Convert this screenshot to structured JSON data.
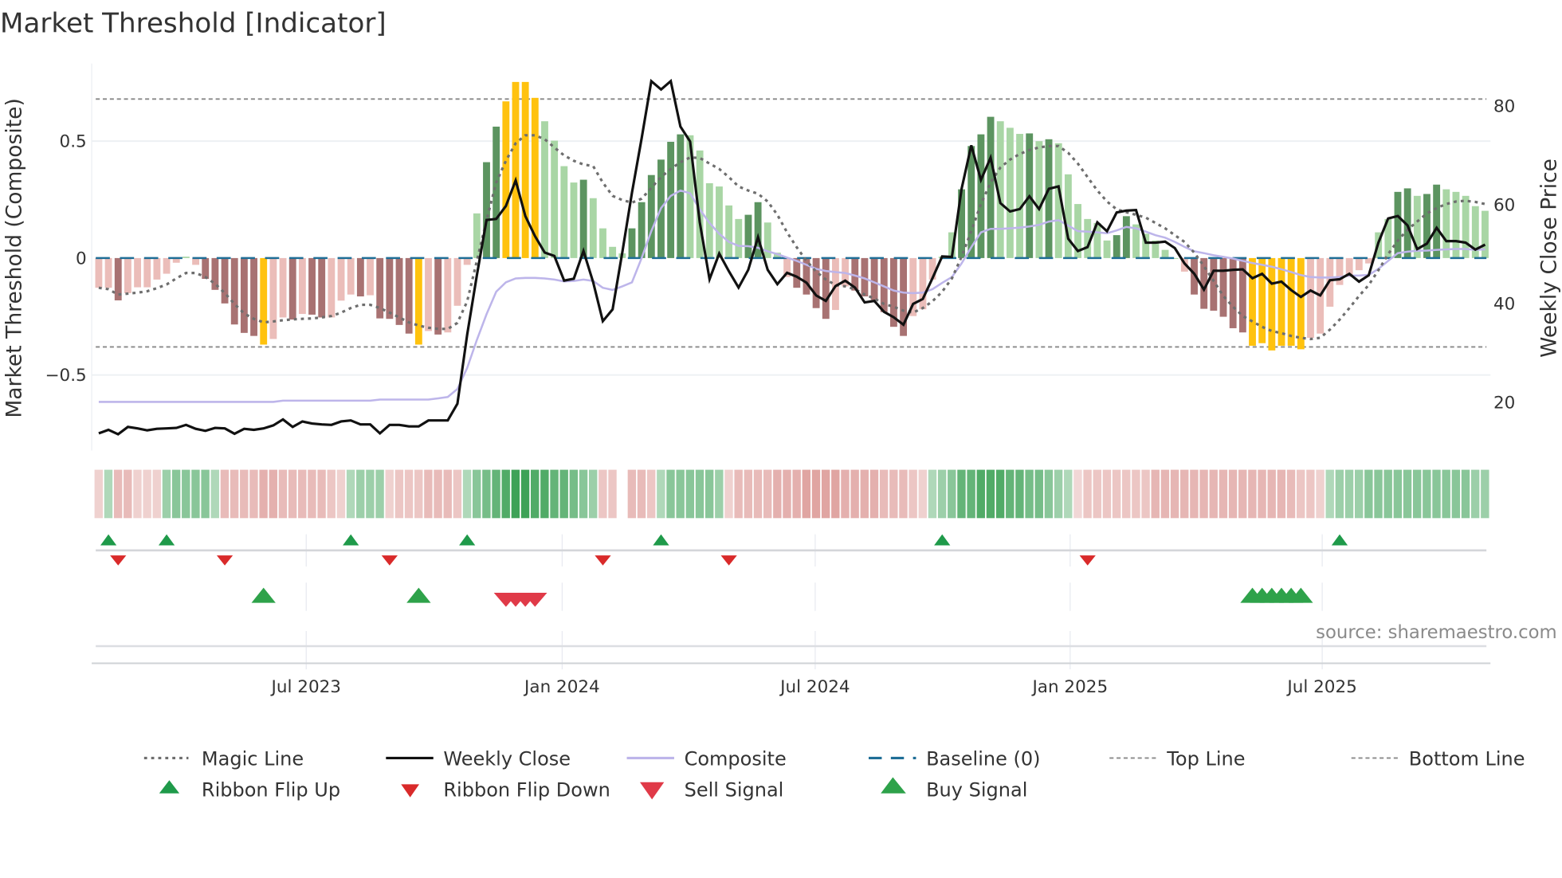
{
  "title": "Market Threshold [Indicator]",
  "source": "source: sharemaestro.com",
  "chart_data": {
    "type": "bar",
    "title": "Market Threshold [Indicator]",
    "ylabel": "Market Threshold (Composite)",
    "ylabel_right": "Weekly Close Price",
    "ylim": [
      -0.8,
      0.78
    ],
    "ylim_right": [
      10,
      90
    ],
    "yticks": [
      {
        "label": "0.5",
        "value": 0.5
      },
      {
        "label": "0",
        "value": 0
      },
      {
        "label": "−0.5",
        "value": -0.5
      }
    ],
    "yticks_right": [
      {
        "label": "80",
        "value": 80
      },
      {
        "label": "60",
        "value": 60
      },
      {
        "label": "40",
        "value": 40
      },
      {
        "label": "20",
        "value": 20
      }
    ],
    "xticks": [
      {
        "label": "Jul 2023",
        "week": 21.4
      },
      {
        "label": "Jan 2024",
        "week": 47.8
      },
      {
        "label": "Jul 2024",
        "week": 73.9
      },
      {
        "label": "Jan 2025",
        "week": 100.2
      },
      {
        "label": "Jul 2025",
        "week": 126.2
      }
    ],
    "top_line": 0.68,
    "bottom_line": -0.38,
    "baseline": 0,
    "grid": true,
    "colors": {
      "up_strong": "#5c9460",
      "up_weak": "#a9d6a5",
      "down_strong": "#a87272",
      "down_weak": "#ebbdb9",
      "extreme": "#ffc20e",
      "weekly_close": "#111111",
      "composite": "#bdb5ea",
      "magic_line": "#6e6e6e",
      "baseline": "#1f6e96",
      "ribbon_up": "#3ea257",
      "ribbon_down": "#d98f8c",
      "flip_up": "#1f9a4a",
      "flip_down": "#d92a2a",
      "buy": "#2ea24a",
      "sell": "#e03a48"
    },
    "histogram": [
      -0.127,
      -0.127,
      -0.181,
      -0.15,
      -0.125,
      -0.125,
      -0.092,
      -0.067,
      -0.02,
      0.006,
      -0.029,
      -0.089,
      -0.136,
      -0.194,
      -0.284,
      -0.32,
      -0.333,
      -0.37,
      -0.346,
      -0.254,
      -0.263,
      -0.239,
      -0.242,
      -0.254,
      -0.254,
      -0.182,
      -0.156,
      -0.164,
      -0.159,
      -0.258,
      -0.26,
      -0.286,
      -0.323,
      -0.37,
      -0.312,
      -0.327,
      -0.318,
      -0.204,
      -0.029,
      0.191,
      0.41,
      0.562,
      0.67,
      0.753,
      0.753,
      0.685,
      0.585,
      0.502,
      0.393,
      0.323,
      0.335,
      0.256,
      0.127,
      0.048,
      0.02,
      0.127,
      0.239,
      0.355,
      0.421,
      0.497,
      0.529,
      0.525,
      0.46,
      0.32,
      0.306,
      0.225,
      0.167,
      0.185,
      0.239,
      0.152,
      0.023,
      -0.081,
      -0.127,
      -0.156,
      -0.214,
      -0.26,
      -0.222,
      -0.121,
      -0.139,
      -0.164,
      -0.179,
      -0.231,
      -0.294,
      -0.333,
      -0.248,
      -0.219,
      -0.092,
      0.006,
      0.11,
      0.294,
      0.479,
      0.529,
      0.604,
      0.585,
      0.557,
      0.531,
      0.533,
      0.5,
      0.508,
      0.491,
      0.358,
      0.231,
      0.167,
      0.15,
      0.075,
      0.098,
      0.179,
      0.144,
      0.104,
      0.075,
      0.035,
      0.0,
      -0.058,
      -0.156,
      -0.217,
      -0.225,
      -0.251,
      -0.3,
      -0.318,
      -0.375,
      -0.364,
      -0.395,
      -0.375,
      -0.375,
      -0.39,
      -0.341,
      -0.323,
      -0.208,
      -0.115,
      -0.081,
      -0.052,
      -0.023,
      0.11,
      0.167,
      0.283,
      0.298,
      0.266,
      0.274,
      0.314,
      0.294,
      0.283,
      0.266,
      0.222,
      0.202
    ],
    "strong_weeks": [
      2,
      11,
      12,
      13,
      14,
      15,
      16,
      20,
      22,
      23,
      27,
      29,
      30,
      31,
      32,
      35,
      40,
      41,
      50,
      55,
      56,
      57,
      58,
      59,
      60,
      67,
      68,
      72,
      73,
      74,
      75,
      78,
      79,
      80,
      81,
      82,
      83,
      89,
      90,
      91,
      92,
      96,
      98,
      105,
      106,
      113,
      114,
      115,
      116,
      117,
      118,
      134,
      135,
      137,
      138
    ],
    "extreme_weeks": [
      17,
      33,
      42,
      43,
      44,
      45,
      119,
      120,
      121,
      122,
      123,
      124
    ],
    "weekly_close": [
      13.5,
      14.2,
      13.3,
      14.8,
      14.5,
      14.1,
      14.4,
      14.5,
      14.6,
      15.2,
      14.4,
      14.0,
      14.6,
      14.5,
      13.4,
      14.4,
      14.2,
      14.5,
      15.1,
      16.3,
      14.8,
      15.9,
      15.5,
      15.3,
      15.2,
      15.9,
      16.1,
      15.3,
      15.3,
      13.5,
      15.2,
      15.2,
      14.9,
      14.9,
      16.1,
      16.1,
      16.1,
      19.5,
      33.5,
      45.5,
      56.7,
      56.9,
      59.5,
      64.7,
      57.5,
      53.4,
      50.1,
      49.4,
      44.4,
      44.8,
      50.4,
      44.1,
      36.2,
      38.6,
      50.1,
      62.2,
      73.2,
      84.8,
      83.1,
      84.8,
      75.6,
      72.6,
      56.2,
      44.7,
      49.9,
      46.3,
      43.0,
      46.6,
      53.2,
      46.6,
      43.7,
      46.0,
      45.2,
      44.0,
      41.4,
      40.3,
      43.3,
      44.4,
      43.0,
      40.0,
      40.3,
      38.1,
      37.0,
      35.5,
      39.7,
      40.7,
      44.9,
      49.3,
      49.2,
      63.0,
      71.8,
      64.8,
      69.3,
      60.1,
      58.4,
      58.9,
      61.5,
      58.9,
      63.0,
      63.5,
      52.9,
      50.4,
      51.2,
      56.2,
      54.4,
      58.2,
      58.6,
      58.7,
      52.1,
      52.1,
      52.3,
      51.0,
      47.9,
      45.8,
      42.6,
      46.4,
      46.4,
      46.6,
      46.7,
      44.9,
      45.8,
      43.8,
      44.2,
      42.5,
      41.1,
      42.4,
      41.4,
      44.5,
      44.7,
      45.8,
      44.2,
      45.5,
      52.1,
      57.0,
      57.5,
      55.6,
      50.8,
      51.9,
      55.1,
      52.4,
      52.4,
      52.1,
      50.7,
      51.7
    ],
    "composite": [
      -0.615,
      -0.615,
      -0.615,
      -0.615,
      -0.615,
      -0.615,
      -0.615,
      -0.615,
      -0.615,
      -0.615,
      -0.615,
      -0.615,
      -0.615,
      -0.615,
      -0.615,
      -0.615,
      -0.615,
      -0.615,
      -0.615,
      -0.61,
      -0.61,
      -0.61,
      -0.61,
      -0.61,
      -0.61,
      -0.61,
      -0.61,
      -0.61,
      -0.61,
      -0.605,
      -0.605,
      -0.605,
      -0.605,
      -0.605,
      -0.605,
      -0.6,
      -0.594,
      -0.56,
      -0.47,
      -0.35,
      -0.24,
      -0.144,
      -0.104,
      -0.087,
      -0.085,
      -0.085,
      -0.087,
      -0.092,
      -0.1,
      -0.098,
      -0.092,
      -0.098,
      -0.127,
      -0.136,
      -0.121,
      -0.104,
      0.0,
      0.115,
      0.214,
      0.266,
      0.289,
      0.277,
      0.208,
      0.15,
      0.104,
      0.069,
      0.052,
      0.051,
      0.044,
      0.029,
      0.017,
      0.002,
      -0.012,
      -0.029,
      -0.046,
      -0.055,
      -0.06,
      -0.064,
      -0.075,
      -0.087,
      -0.104,
      -0.121,
      -0.139,
      -0.148,
      -0.15,
      -0.148,
      -0.133,
      -0.106,
      -0.081,
      -0.023,
      0.046,
      0.11,
      0.125,
      0.125,
      0.127,
      0.13,
      0.135,
      0.142,
      0.156,
      0.162,
      0.139,
      0.115,
      0.113,
      0.11,
      0.106,
      0.118,
      0.133,
      0.127,
      0.113,
      0.098,
      0.087,
      0.069,
      0.048,
      0.029,
      0.021,
      0.012,
      0.005,
      -0.002,
      -0.012,
      -0.021,
      -0.029,
      -0.037,
      -0.048,
      -0.06,
      -0.073,
      -0.081,
      -0.083,
      -0.083,
      -0.081,
      -0.075,
      -0.075,
      -0.072,
      -0.046,
      -0.012,
      0.021,
      0.027,
      0.031,
      0.032,
      0.035,
      0.037,
      0.039,
      0.039,
      0.035,
      0.037
    ],
    "magic_line": [
      -0.127,
      -0.133,
      -0.156,
      -0.152,
      -0.148,
      -0.142,
      -0.129,
      -0.113,
      -0.087,
      -0.064,
      -0.064,
      -0.081,
      -0.11,
      -0.15,
      -0.196,
      -0.237,
      -0.26,
      -0.275,
      -0.271,
      -0.266,
      -0.262,
      -0.26,
      -0.258,
      -0.254,
      -0.248,
      -0.233,
      -0.214,
      -0.2,
      -0.2,
      -0.214,
      -0.233,
      -0.254,
      -0.275,
      -0.289,
      -0.298,
      -0.303,
      -0.303,
      -0.277,
      -0.185,
      -0.012,
      0.162,
      0.323,
      0.416,
      0.491,
      0.525,
      0.525,
      0.508,
      0.473,
      0.439,
      0.416,
      0.4,
      0.393,
      0.323,
      0.266,
      0.248,
      0.237,
      0.254,
      0.3,
      0.346,
      0.381,
      0.41,
      0.43,
      0.428,
      0.404,
      0.381,
      0.346,
      0.306,
      0.289,
      0.275,
      0.242,
      0.185,
      0.11,
      0.046,
      -0.012,
      -0.058,
      -0.092,
      -0.115,
      -0.121,
      -0.133,
      -0.156,
      -0.173,
      -0.196,
      -0.208,
      -0.225,
      -0.233,
      -0.214,
      -0.185,
      -0.144,
      -0.087,
      0.006,
      0.115,
      0.231,
      0.323,
      0.387,
      0.421,
      0.445,
      0.462,
      0.473,
      0.479,
      0.479,
      0.45,
      0.404,
      0.346,
      0.289,
      0.242,
      0.208,
      0.196,
      0.185,
      0.173,
      0.15,
      0.127,
      0.098,
      0.069,
      0.023,
      -0.035,
      -0.098,
      -0.162,
      -0.208,
      -0.248,
      -0.271,
      -0.294,
      -0.312,
      -0.321,
      -0.333,
      -0.341,
      -0.346,
      -0.341,
      -0.306,
      -0.263,
      -0.214,
      -0.162,
      -0.115,
      -0.052,
      0.017,
      0.075,
      0.121,
      0.156,
      0.191,
      0.214,
      0.231,
      0.242,
      0.245,
      0.24,
      0.231
    ],
    "ribbon": [
      -1,
      1,
      -2,
      -2,
      -1,
      -1,
      -1,
      1.5,
      2,
      2,
      2,
      2,
      1,
      -2,
      -2,
      -2,
      -2,
      -2.5,
      -2.5,
      -2,
      -2,
      -2,
      -2,
      -2,
      -1.5,
      -1,
      1,
      1.5,
      1.5,
      1.5,
      -1,
      -1.5,
      -1.5,
      -1.5,
      -2,
      -2,
      -2,
      -1.5,
      1,
      2,
      2.5,
      3,
      3.5,
      4,
      4,
      3.5,
      3.5,
      3,
      3,
      2.5,
      2,
      1.5,
      -1.5,
      -1.5,
      0,
      -2,
      -2,
      -1.5,
      1,
      2,
      2,
      2,
      2,
      2,
      1.5,
      -1,
      -2,
      -2,
      -2,
      -2,
      -2.5,
      -2.5,
      -2.5,
      -3,
      -3,
      -3,
      -3,
      -2.5,
      -2.5,
      -2.5,
      -2.5,
      -2,
      -2,
      -2,
      -1.5,
      -1,
      1,
      1.5,
      2,
      3,
      3,
      3.5,
      3.5,
      3.5,
      3,
      3,
      2.5,
      2.5,
      2,
      1.5,
      1,
      -0.7,
      -1.5,
      -1.5,
      -1.5,
      -1.5,
      -1.5,
      -1.5,
      -1.5,
      -2.2,
      -2.2,
      -2.2,
      -2.2,
      -2.2,
      -2.2,
      -2.2,
      -2.2,
      -2.2,
      -2.2,
      -2.2,
      -2.2,
      -2.2,
      -2.2,
      -2,
      -1.5,
      -1.5,
      -1,
      1,
      1.5,
      1.5,
      1.5,
      2,
      2,
      2,
      2,
      2,
      2,
      2,
      2,
      2,
      2,
      2,
      1.5,
      1.5
    ],
    "ribbon_flip_up": [
      1,
      7,
      26,
      38,
      58,
      87,
      128
    ],
    "ribbon_flip_down": [
      2,
      13,
      30,
      52,
      65,
      102
    ],
    "buy_signal": [
      17,
      33,
      119,
      120,
      121,
      122,
      123,
      124
    ],
    "sell_signal": [
      42,
      43,
      44,
      45
    ],
    "legend_placement": "bottom",
    "legend": [
      {
        "label": "Magic Line",
        "kind": "dotted"
      },
      {
        "label": "Weekly Close",
        "kind": "line"
      },
      {
        "label": "Composite",
        "kind": "line"
      },
      {
        "label": "Baseline (0)",
        "kind": "dashed"
      },
      {
        "label": "Top Line",
        "kind": "dashed"
      },
      {
        "label": "Bottom Line",
        "kind": "dashed"
      },
      {
        "label": "Ribbon Flip Up",
        "kind": "marker"
      },
      {
        "label": "Ribbon Flip Down",
        "kind": "marker"
      },
      {
        "label": "Sell Signal",
        "kind": "marker"
      },
      {
        "label": "Buy Signal",
        "kind": "marker"
      }
    ]
  }
}
